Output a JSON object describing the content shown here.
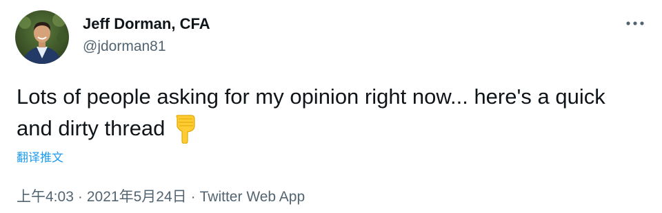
{
  "tweet": {
    "author": {
      "display_name": "Jeff Dorman, CFA",
      "handle": "@jdorman81"
    },
    "text": "Lots of people asking for my opinion right now... here's a quick and dirty thread",
    "emoji": "backhand-index-pointing-down-emoji",
    "translate_label": "翻译推文",
    "time": "上午4:03",
    "date": "2021年5月24日",
    "separator": "·",
    "source": "Twitter Web App",
    "more_icon": "more-horizontal-icon",
    "colors": {
      "text": "#0f1419",
      "secondary": "#536471",
      "link": "#1d9bf0"
    }
  }
}
